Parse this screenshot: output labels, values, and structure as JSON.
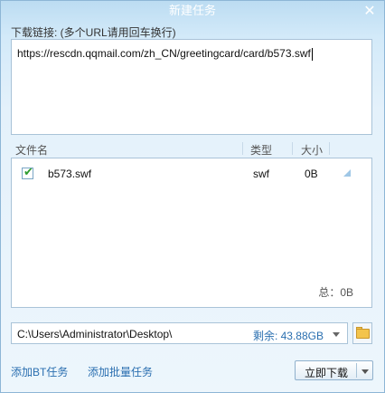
{
  "window": {
    "title": "新建任务",
    "close_glyph": "✕"
  },
  "url_section": {
    "label": "下载链接: (多个URL请用回车换行)",
    "value": "https://rescdn.qqmail.com/zh_CN/greetingcard/card/b573.swf"
  },
  "file_list": {
    "columns": {
      "name": "文件名",
      "type": "类型",
      "size": "大小"
    },
    "rows": [
      {
        "checked": true,
        "check_glyph": "✔",
        "name": "b573.swf",
        "type": "swf",
        "size": "0B"
      }
    ],
    "total": "总：0B"
  },
  "save_path": {
    "path": "C:\\Users\\Administrator\\Desktop\\",
    "free_space": "剩余: 43.88GB"
  },
  "footer": {
    "add_bt_link": "添加BT任务",
    "add_batch_link": "添加批量任务",
    "download_button": "立即下载"
  },
  "icons": {
    "close": "close-icon",
    "check": "checkmark-icon",
    "folder": "folder-icon",
    "dropdown": "chevron-down-icon",
    "sort": "resize-corner-icon"
  },
  "colors": {
    "accent": "#2a6fb0",
    "title_bar": "#bcdcf2",
    "check_green": "#2e9c2e",
    "folder_yellow": "#f3c44c"
  }
}
